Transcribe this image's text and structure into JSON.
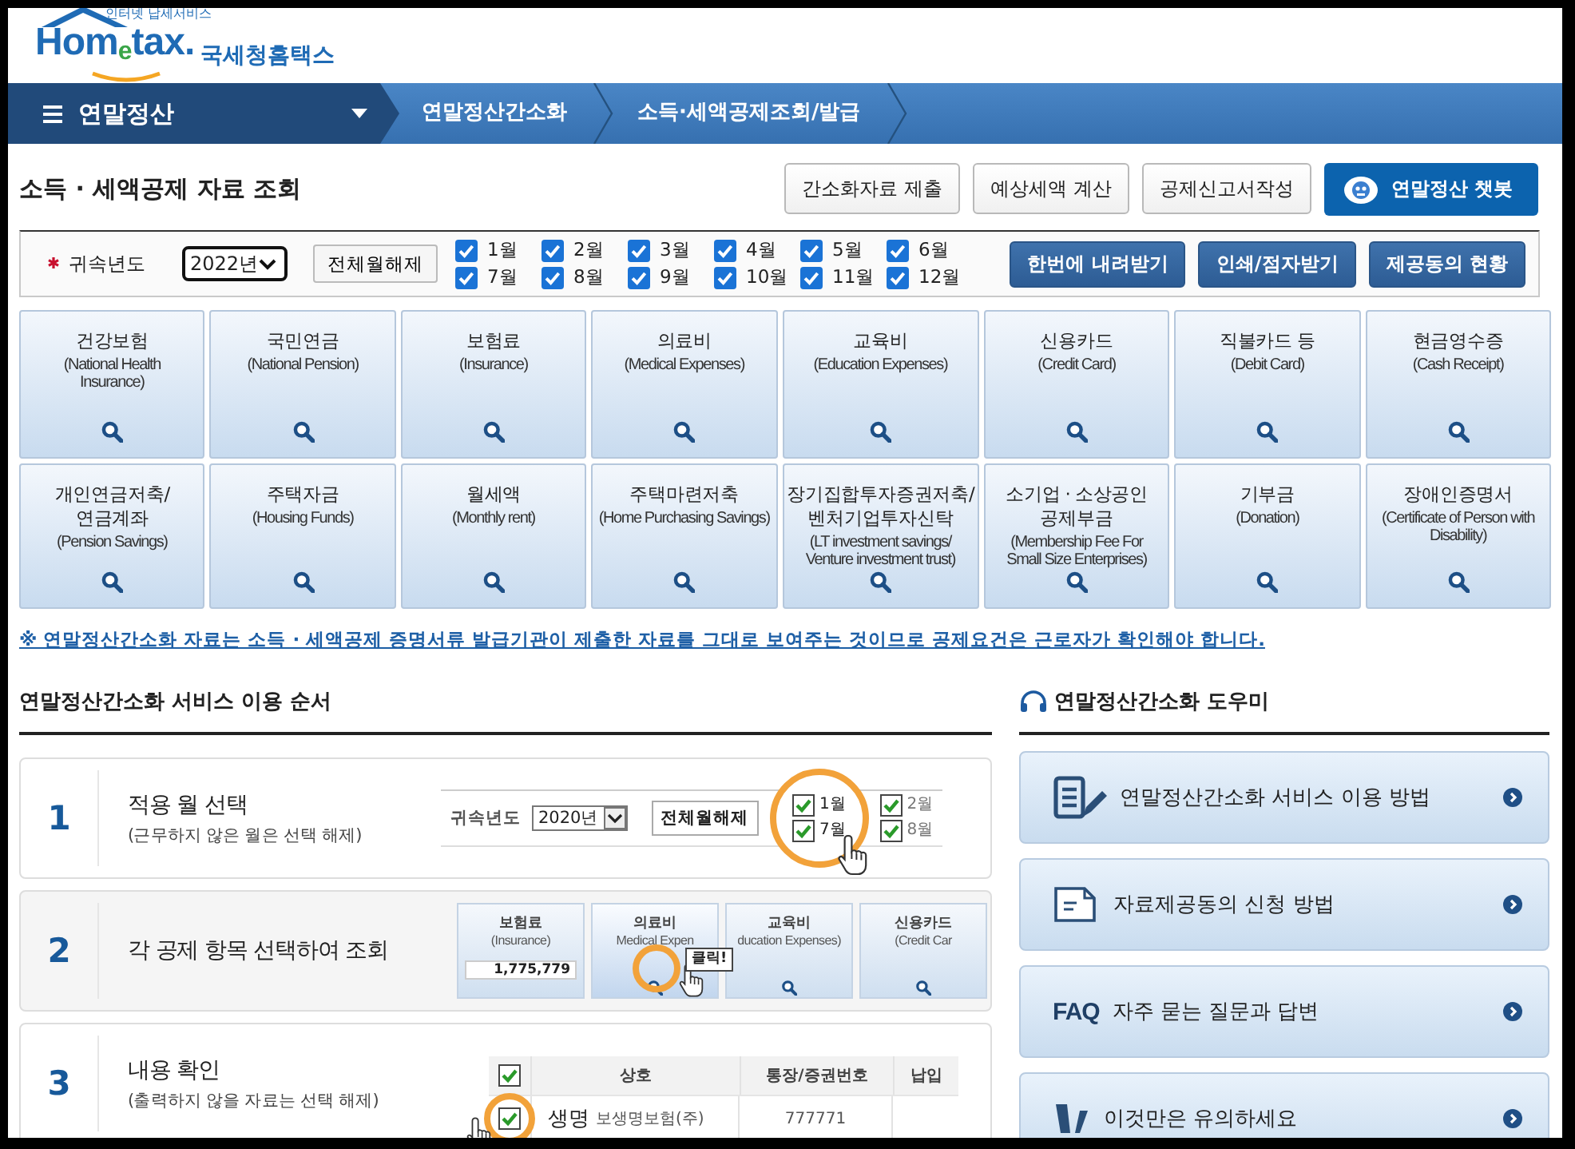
{
  "logo": {
    "tagline": "인터넷 납세서비스",
    "brand": "Hom$_{e}$tax.",
    "name": "국세청홈택스"
  },
  "nav": {
    "menu": "연말정산",
    "breadcrumbs": [
      "연말정산간소화",
      "소득·세액공제조회/발급"
    ]
  },
  "page_title": "소득 · 세액공제 자료 조회",
  "top_buttons": [
    {
      "label": "간소화자료 제출",
      "kind": "plain"
    },
    {
      "label": "예상세액 계산",
      "kind": "plain"
    },
    {
      "label": "공제신고서작성",
      "kind": "plain"
    },
    {
      "label": "연말정산 챗봇",
      "kind": "chatbot"
    }
  ],
  "filter": {
    "label": "귀속년도",
    "required": true,
    "year": "2022년",
    "clear_button": "전체월해제",
    "months": [
      {
        "label": "1월",
        "checked": true
      },
      {
        "label": "2월",
        "checked": true
      },
      {
        "label": "3월",
        "checked": true
      },
      {
        "label": "4월",
        "checked": true
      },
      {
        "label": "5월",
        "checked": true
      },
      {
        "label": "6월",
        "checked": true
      },
      {
        "label": "7월",
        "checked": true
      },
      {
        "label": "8월",
        "checked": true
      },
      {
        "label": "9월",
        "checked": true
      },
      {
        "label": "10월",
        "checked": true
      },
      {
        "label": "11월",
        "checked": true
      },
      {
        "label": "12월",
        "checked": true
      }
    ],
    "actions": [
      "한번에 내려받기",
      "인쇄/점자받기",
      "제공동의 현황"
    ]
  },
  "categories": [
    {
      "name": "건강보험",
      "english": "(National Health\nInsurance)"
    },
    {
      "name": "국민연금",
      "english": "(National Pension)"
    },
    {
      "name": "보험료",
      "english": "(Insurance)"
    },
    {
      "name": "의료비",
      "english": "(Medical Expenses)"
    },
    {
      "name": "교육비",
      "english": "(Education Expenses)"
    },
    {
      "name": "신용카드",
      "english": "(Credit Card)"
    },
    {
      "name": "직불카드 등",
      "english": "(Debit Card)"
    },
    {
      "name": "현금영수증",
      "english": "(Cash Receipt)"
    },
    {
      "name": "개인연금저축/\n연금계좌",
      "english": "(Pension Savings)"
    },
    {
      "name": "주택자금",
      "english": "(Housing Funds)"
    },
    {
      "name": "월세액",
      "english": "(Monthly rent)"
    },
    {
      "name": "주택마련저축",
      "english": "(Home Purchasing Savings)"
    },
    {
      "name": "장기집합투자증권저축/\n벤처기업투자신탁",
      "english": "(LT investment savings/\nVenture investment trust)"
    },
    {
      "name": "소기업 · 소상공인\n공제부금",
      "english": "(Membership Fee For\nSmall Size Enterprises)"
    },
    {
      "name": "기부금",
      "english": "(Donation)"
    },
    {
      "name": "장애인증명서",
      "english": "(Certificate of Person with\nDisability)"
    }
  ],
  "notice": "※ 연말정산간소화 자료는 소득 · 세액공제 증명서류 발급기관이 제출한 자료를 그대로 보여주는 것이므로 공제요건은 근로자가 확인해야 합니다.",
  "guide": {
    "title": "연말정산간소화 서비스 이용 순서",
    "steps": [
      {
        "number": "1",
        "title": "적용 월 선택",
        "note": "(근무하지 않은 월은 선택 해제)",
        "kind": "months",
        "illustration": {
          "label": "귀속년도",
          "year": "2020년",
          "button": "전체월해제",
          "months": [
            {
              "label": "1월",
              "checked": true
            },
            {
              "label": "7월",
              "checked": true
            },
            {
              "label": "2월",
              "checked": true
            },
            {
              "label": "8월",
              "checked": true
            }
          ]
        }
      },
      {
        "number": "2",
        "title": "각 공제 항목 선택하여 조회",
        "kind": "tiles",
        "illustration": {
          "tiles": [
            {
              "name": "보험료",
              "english": "(Insurance)",
              "amount": "1,775,779"
            },
            {
              "name": "의료비",
              "english": "Medical Expen"
            },
            {
              "name": "교육비",
              "english": "ducation Expenses)"
            },
            {
              "name": "신용카드",
              "english": "(Credit Car"
            }
          ],
          "tooltip": "클릭!"
        }
      },
      {
        "number": "3",
        "title": "내용 확인",
        "note": "(출력하지 않을 자료는 선택 해제)",
        "kind": "table",
        "illustration": {
          "header_checked": true,
          "columns": [
            "상호",
            "통장/증권번호",
            "납입"
          ],
          "rows": [
            {
              "checked": true,
              "magnified": "생명",
              "cells": [
                "보생명보험(주)",
                "777771"
              ]
            }
          ]
        }
      }
    ]
  },
  "help": {
    "title": "연말정산간소화 도우미",
    "items": [
      {
        "label": "연말정산간소화 서비스 이용 방법",
        "kind": "document"
      },
      {
        "label": "자료제공동의 신청 방법",
        "kind": "form"
      },
      {
        "label": "자주 묻는 질문과 답변",
        "kind": "faq",
        "badge": "FAQ"
      },
      {
        "label": "이것만은 유의하세요",
        "kind": "caution"
      }
    ]
  }
}
